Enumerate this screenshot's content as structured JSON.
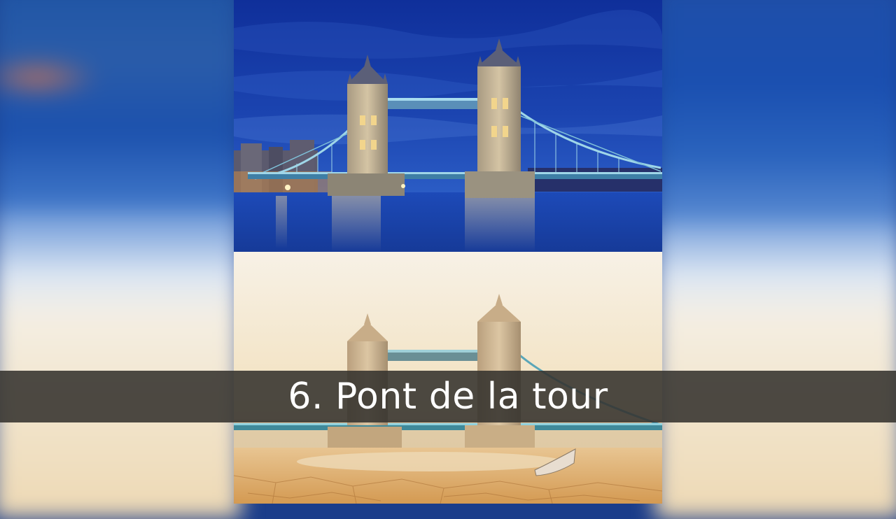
{
  "caption": "6. Pont de la tour",
  "colors": {
    "night_sky": "#1436a0",
    "day_sky": "#f6ecd9",
    "dry_riverbed": "#d9a865",
    "caption_band": "#34322e",
    "caption_text": "#ffffff"
  },
  "images": {
    "top": "tower-bridge-night-photo",
    "bottom": "tower-bridge-dry-river-photo"
  }
}
